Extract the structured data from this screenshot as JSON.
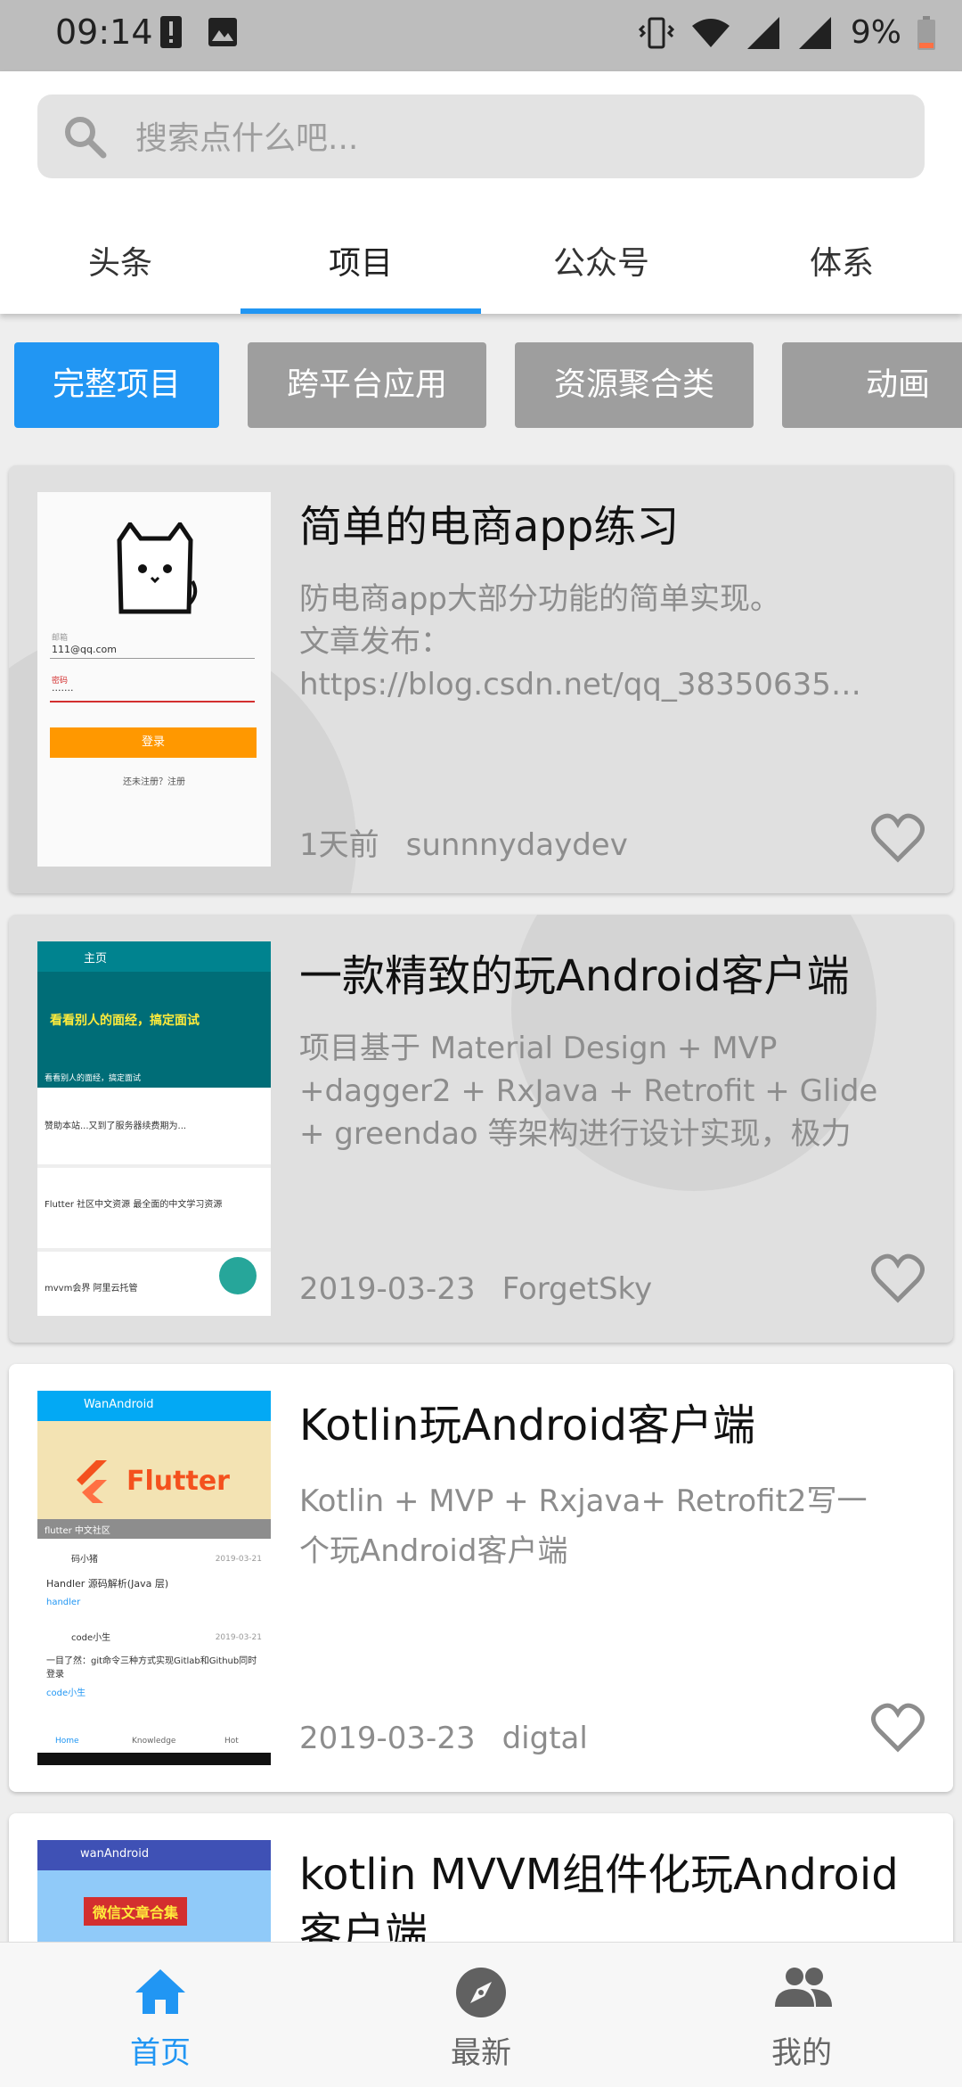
{
  "status_bar": {
    "time": "09:14",
    "battery_percent": "9%"
  },
  "search": {
    "placeholder": "搜索点什么吧..."
  },
  "tabs": [
    {
      "label": "头条",
      "active": false
    },
    {
      "label": "项目",
      "active": true
    },
    {
      "label": "公众号",
      "active": false
    },
    {
      "label": "体系",
      "active": false
    }
  ],
  "chips": [
    {
      "label": "完整项目",
      "active": true
    },
    {
      "label": "跨平台应用",
      "active": false
    },
    {
      "label": "资源聚合类",
      "active": false
    },
    {
      "label": "动画",
      "active": false
    }
  ],
  "cards": [
    {
      "title": "简单的电商app练习",
      "desc": "防电商app大部分功能的简单实现。\n文章发布：\nhttps://blog.csdn.net/qq_38350635…",
      "time": "1天前",
      "author": "sunnnydaydev",
      "thumb": {
        "email_label": "邮箱",
        "email_value": "111@qq.com",
        "password_label": "密码",
        "password_value": "·······",
        "login_button": "登录",
        "register_text": "还未注册？注册"
      }
    },
    {
      "title": "一款精致的玩Android客户端",
      "desc": "项目基于 Material Design + MVP +dagger2 + RxJava + Retrofit + Glide + greendao 等架构进行设计实现，极力打…",
      "time": "2019-03-23",
      "author": "ForgetSky",
      "thumb": {
        "header": "主页",
        "banner_text": "看看别人的面经，搞定面试",
        "banner_sub": "看看别人的面经，搞定面试",
        "item1": "赞助本站...又到了服务器续费期为...",
        "item2": "Flutter 社区中文资源 最全面的中文学习资源",
        "item3": "mvvm会界 阿里云托管"
      }
    },
    {
      "title": "Kotlin玩Android客户端",
      "desc": "Kotlin + MVP + Rxjava+ Retrofit2写一个玩Android客户端",
      "time": "2019-03-23",
      "author": "digtal",
      "thumb": {
        "header": "WanAndroid",
        "banner": "Flutter",
        "banner_caption": "flutter 中文社区",
        "user1": "码小猪",
        "date1": "2019-03-21",
        "post1": "Handler 源码解析(Java 层)",
        "tag1": "handler",
        "user2": "code小生",
        "date2": "2019-03-21",
        "post2": "一目了然：git命令三种方式实现Gitlab和Github同时登录",
        "tag2": "code小生",
        "nav1": "Home",
        "nav2": "Knowledge",
        "nav3": "Hot"
      }
    },
    {
      "title": "kotlin MVVM组件化玩Android客户端",
      "thumb": {
        "header": "wanAndroid",
        "badge": "微信文章合集"
      }
    }
  ],
  "bottom_nav": [
    {
      "label": "首页",
      "icon": "home-icon",
      "active": true
    },
    {
      "label": "最新",
      "icon": "compass-icon",
      "active": false
    },
    {
      "label": "我的",
      "icon": "people-icon",
      "active": false
    }
  ],
  "colors": {
    "accent": "#2196f3",
    "chip_inactive": "#9e9e9e",
    "status_bar": "#bdbdbd"
  }
}
